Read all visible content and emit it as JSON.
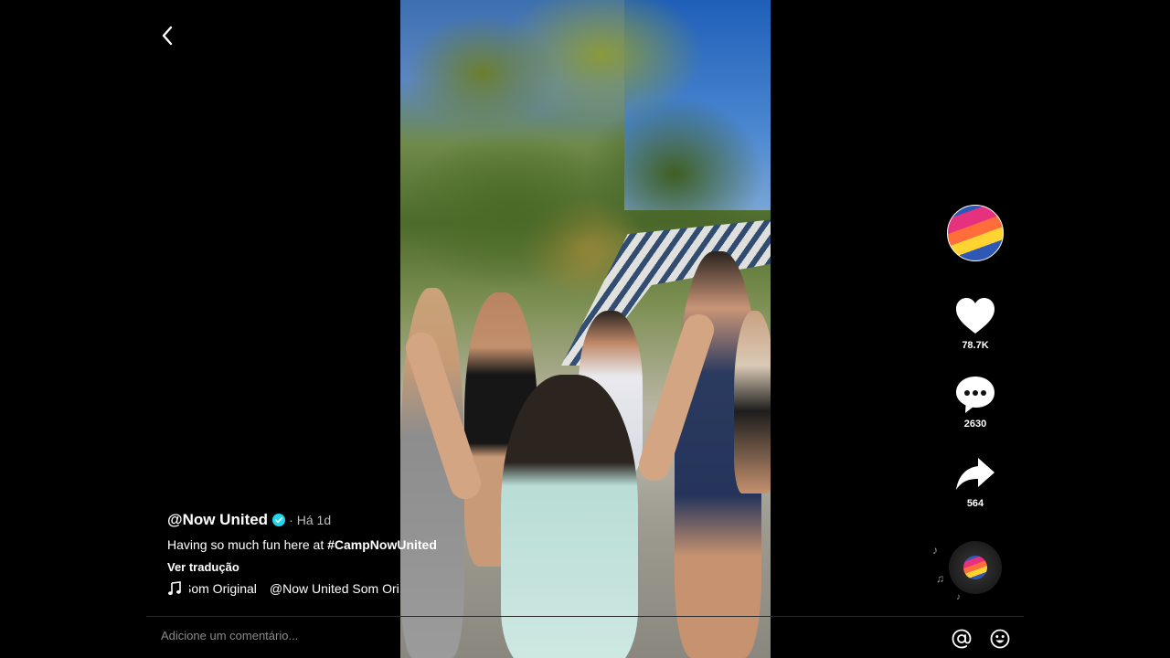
{
  "video": {
    "author": "@Now United",
    "verified": true,
    "time_separator": "·",
    "posted": "Há 1d",
    "description_text": "Having so much fun here at ",
    "description_hashtag": "#CampNowUnited",
    "translate_label": "Ver tradução",
    "music_title": "Som Original",
    "music_author": "@Now United Som Ori"
  },
  "actions": {
    "likes": "78.7K",
    "comments": "2630",
    "shares": "564"
  },
  "comment_bar": {
    "placeholder": "Adicione um comentário..."
  },
  "icons": {
    "back": "chevron-left-icon",
    "like": "heart-icon",
    "comment": "speech-bubble-icon",
    "share": "share-arrow-icon",
    "mention": "at-sign-icon",
    "emoji": "smiley-icon",
    "music": "music-note-icon",
    "verified": "verified-badge-icon"
  },
  "colors": {
    "background": "#000000",
    "text": "#ffffff",
    "muted": "#8a8a8a",
    "verified": "#20d5ec"
  }
}
